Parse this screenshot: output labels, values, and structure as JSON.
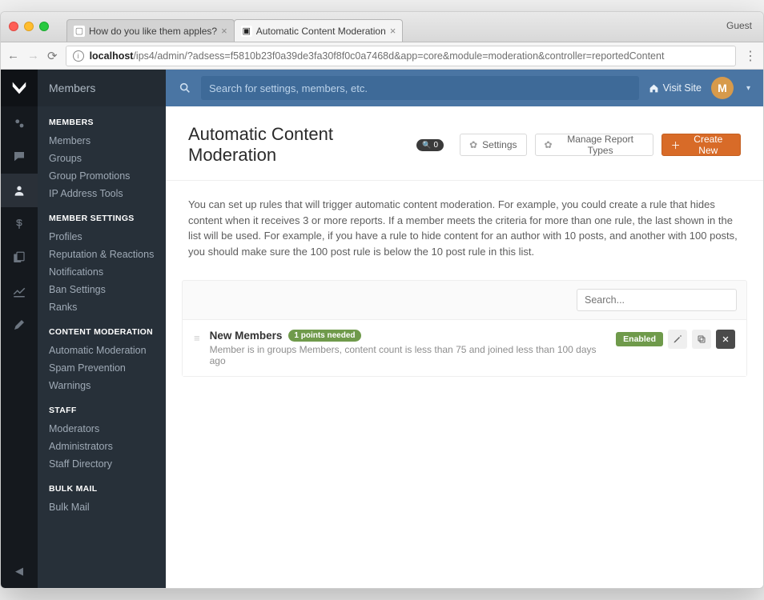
{
  "browser": {
    "guest": "Guest",
    "tabs": [
      {
        "title": "How do you like them apples?"
      },
      {
        "title": "Automatic Content Moderation"
      }
    ],
    "url_host": "localhost",
    "url_path": "/ips4/admin/?adsess=f5810b23f0a39de3fa30f8f0c0a7468d&app=core&module=moderation&controller=reportedContent"
  },
  "sidebar": {
    "title": "Members",
    "groups": [
      {
        "heading": "MEMBERS",
        "items": [
          "Members",
          "Groups",
          "Group Promotions",
          "IP Address Tools"
        ]
      },
      {
        "heading": "MEMBER SETTINGS",
        "items": [
          "Profiles",
          "Reputation & Reactions",
          "Notifications",
          "Ban Settings",
          "Ranks"
        ]
      },
      {
        "heading": "CONTENT MODERATION",
        "items": [
          "Automatic Moderation",
          "Spam Prevention",
          "Warnings"
        ]
      },
      {
        "heading": "STAFF",
        "items": [
          "Moderators",
          "Administrators",
          "Staff Directory"
        ]
      },
      {
        "heading": "BULK MAIL",
        "items": [
          "Bulk Mail"
        ]
      }
    ]
  },
  "topbar": {
    "search_placeholder": "Search for settings, members, etc.",
    "visit_site": "Visit Site",
    "avatar_initial": "M"
  },
  "page": {
    "title": "Automatic Content Moderation",
    "count_badge": "0",
    "btn_settings": "Settings",
    "btn_manage": "Manage Report Types",
    "btn_create": "Create New",
    "intro": "You can set up rules that will trigger automatic content moderation. For example, you could create a rule that hides content when it receives 3 or more reports. If a member meets the criteria for more than one rule, the last shown in the list will be used. For example, if you have a rule to hide content for an author with 10 posts, and another with 100 posts, you should make sure the 100 post rule is below the 10 post rule in this list.",
    "list_search_placeholder": "Search..."
  },
  "rules": [
    {
      "name": "New Members",
      "points": "1 points needed",
      "desc": "Member is in groups Members, content count is less than 75 and joined less than 100 days ago",
      "status": "Enabled"
    }
  ]
}
